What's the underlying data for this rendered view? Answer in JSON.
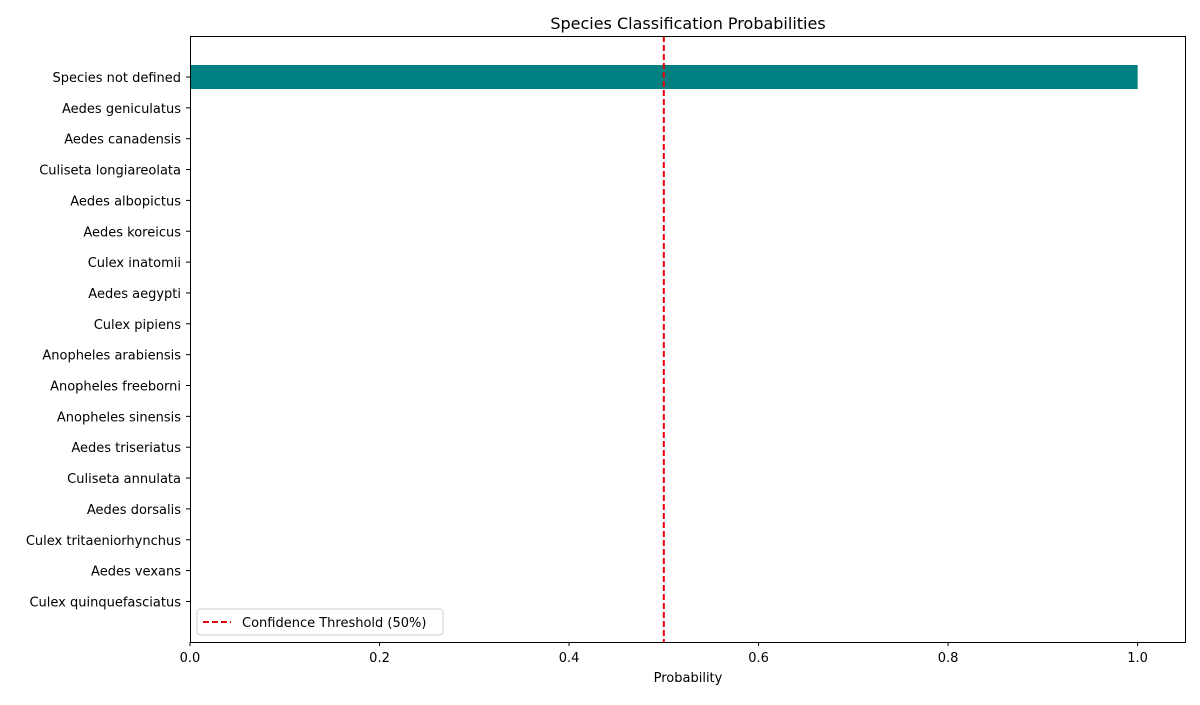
{
  "chart_data": {
    "type": "bar",
    "orientation": "horizontal",
    "title": "Species Classification Probabilities",
    "xlabel": "Probability",
    "ylabel": "",
    "xlim": [
      0.0,
      1.05
    ],
    "xticks": [
      "0.0",
      "0.2",
      "0.4",
      "0.6",
      "0.8",
      "1.0"
    ],
    "xtick_values": [
      0.0,
      0.2,
      0.4,
      0.6,
      0.8,
      1.0
    ],
    "categories": [
      "Species not defined",
      "Aedes geniculatus",
      "Aedes canadensis",
      "Culiseta longiareolata",
      "Aedes albopictus",
      "Aedes koreicus",
      "Culex inatomii",
      "Aedes aegypti",
      "Culex pipiens",
      "Anopheles arabiensis",
      "Anopheles freeborni",
      "Anopheles sinensis",
      "Aedes triseriatus",
      "Culiseta annulata",
      "Aedes dorsalis",
      "Culex tritaeniorhynchus",
      "Aedes vexans",
      "Culex quinquefasciatus"
    ],
    "values": [
      1.0,
      0.0,
      0.0,
      0.0,
      0.0,
      0.0,
      0.0,
      0.0,
      0.0,
      0.0,
      0.0,
      0.0,
      0.0,
      0.0,
      0.0,
      0.0,
      0.0,
      0.0
    ],
    "bar_color": "#008080",
    "threshold": {
      "value": 0.5,
      "label": "Confidence Threshold (50%)",
      "color": "#e8000b",
      "style": "dashed"
    },
    "grid": false,
    "legend_position": "lower-left"
  }
}
